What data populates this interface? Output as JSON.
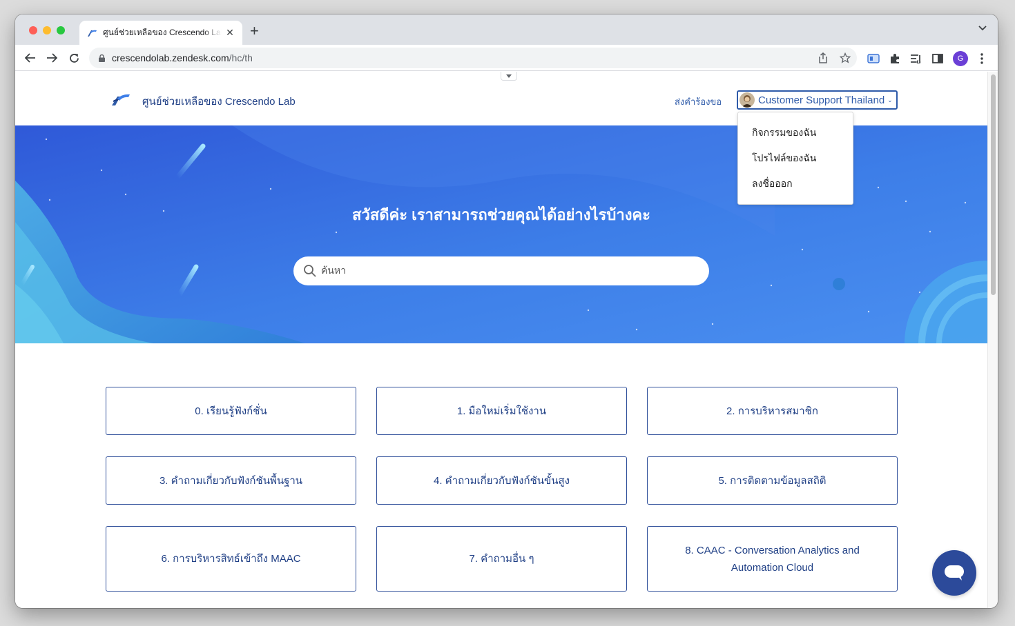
{
  "browser": {
    "tab_title": "ศูนย์ช่วยเหลือของ Crescendo Lab",
    "tab_close": "✕",
    "new_tab": "+",
    "url_host": "crescendolab.zendesk.com",
    "url_path": "/hc/th",
    "profile_initial": "G"
  },
  "header": {
    "site_name": "ศูนย์ช่วยเหลือของ Crescendo Lab",
    "submit_request": "ส่งคำร้องขอ",
    "user_name": "Customer Support Thailand",
    "user_caret": "⌄"
  },
  "user_menu": {
    "items": [
      "กิจกรรมของฉัน",
      "โปรไฟล์ของฉัน",
      "ลงชื่อออก"
    ]
  },
  "hero": {
    "title": "สวัสดีค่ะ เราสามารถช่วยคุณได้อย่างไรบ้างคะ",
    "search_placeholder": "ค้นหา"
  },
  "categories": [
    "0. เรียนรู้ฟังก์ชั่น",
    "1. มือใหม่เริ่มใช้งาน",
    "2. การบริหารสมาชิก",
    "3. คำถามเกี่ยวกับฟังก์ชันพื้นฐาน",
    "4. คำถามเกี่ยวกับฟังก์ชันขั้นสูง",
    "5. การติดตามข้อมูลสถิติ",
    "6. การบริหารสิทธ์เข้าถึง MAAC",
    "7. คำถามอื่น ๆ",
    "8. CAAC - Conversation Analytics and Automation Cloud"
  ],
  "colors": {
    "brand_navy": "#1f3f85",
    "link_blue": "#2f5ba9",
    "hero_blue": "#3f7fe8",
    "chat_button": "#2c4a9a"
  }
}
